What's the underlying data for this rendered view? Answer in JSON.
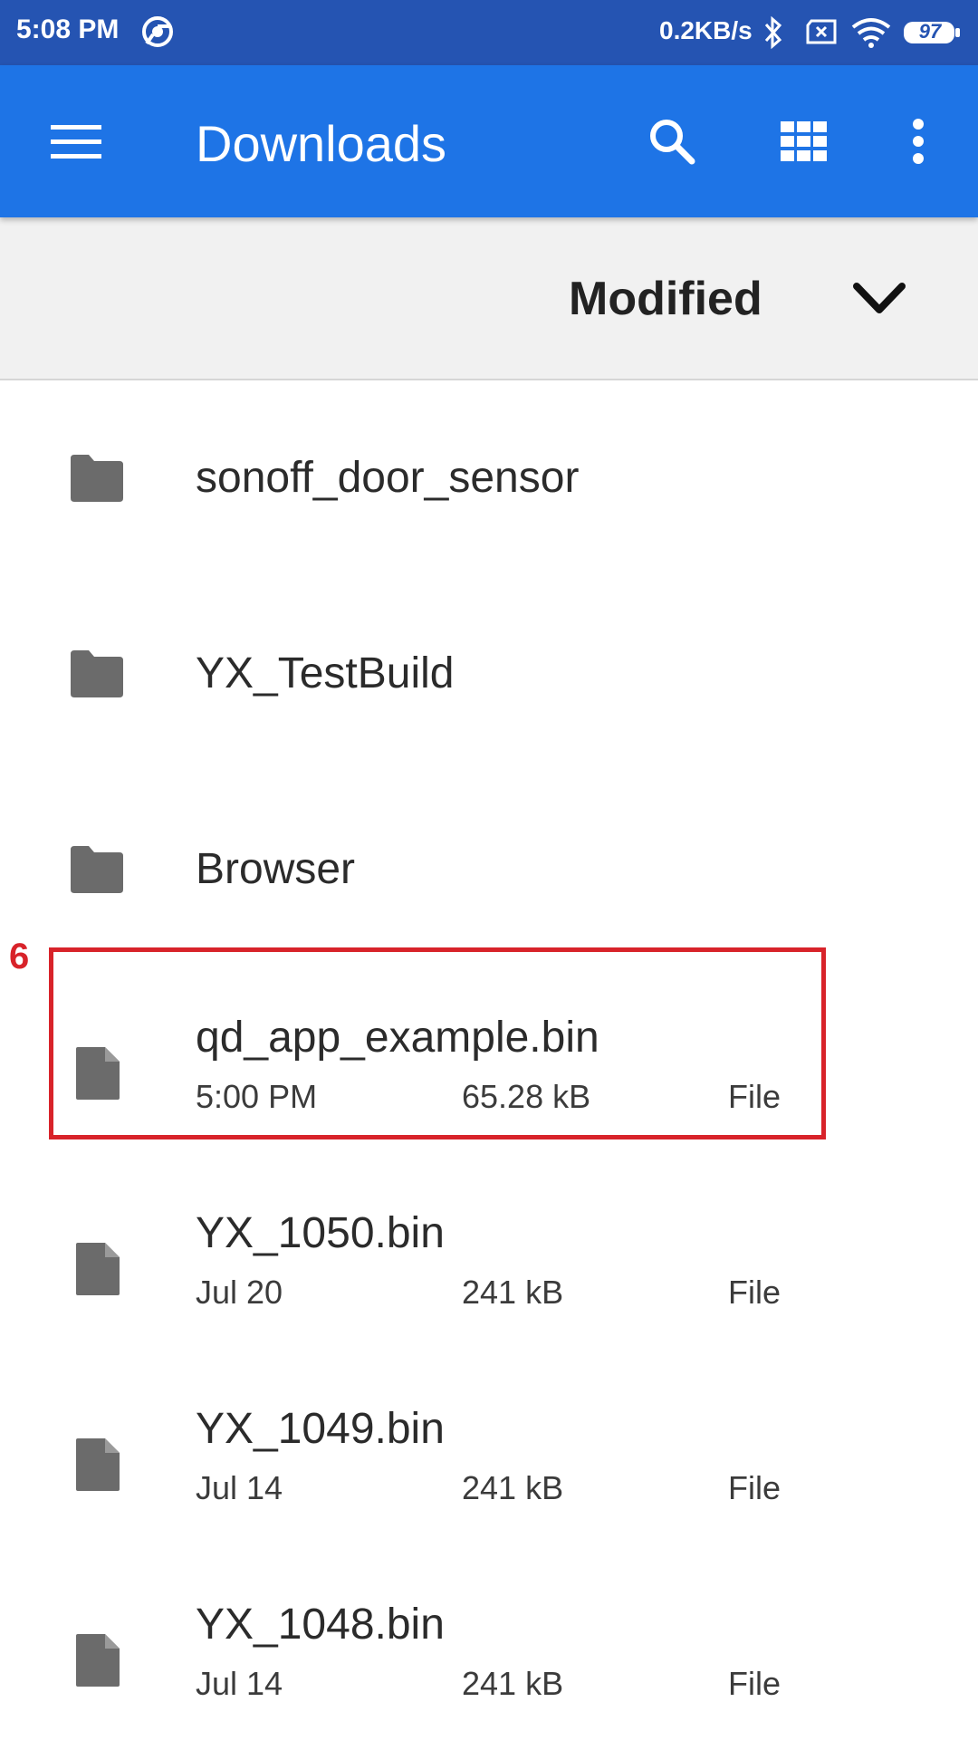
{
  "status_bar": {
    "time": "5:08 PM",
    "net_speed": "0.2KB/s",
    "battery": "97",
    "icons": [
      "chrome-icon",
      "bluetooth-icon",
      "sim-icon",
      "wifi-icon",
      "battery-icon"
    ]
  },
  "app_bar": {
    "title": "Downloads",
    "icons": [
      "menu-icon",
      "search-icon",
      "grid-view-icon",
      "more-vert-icon"
    ],
    "color": "#1e74e6"
  },
  "sort": {
    "label": "Modified",
    "icon": "chevron-down-icon"
  },
  "folders": [
    {
      "name": "sonoff_door_sensor",
      "icon": "folder-icon"
    },
    {
      "name": "YX_TestBuild",
      "icon": "folder-icon"
    },
    {
      "name": "Browser",
      "icon": "folder-icon"
    }
  ],
  "files": [
    {
      "name": "qd_app_example.bin",
      "date": "5:00 PM",
      "size": "65.28 kB",
      "type": "File",
      "icon": "file-icon"
    },
    {
      "name": "YX_1050.bin",
      "date": "Jul 20",
      "size": "241 kB",
      "type": "File",
      "icon": "file-icon"
    },
    {
      "name": "YX_1049.bin",
      "date": "Jul 14",
      "size": "241 kB",
      "type": "File",
      "icon": "file-icon"
    },
    {
      "name": "YX_1048.bin",
      "date": "Jul 14",
      "size": "241 kB",
      "type": "File",
      "icon": "file-icon"
    }
  ],
  "annotation": {
    "label": "6",
    "color": "#d8232a"
  }
}
